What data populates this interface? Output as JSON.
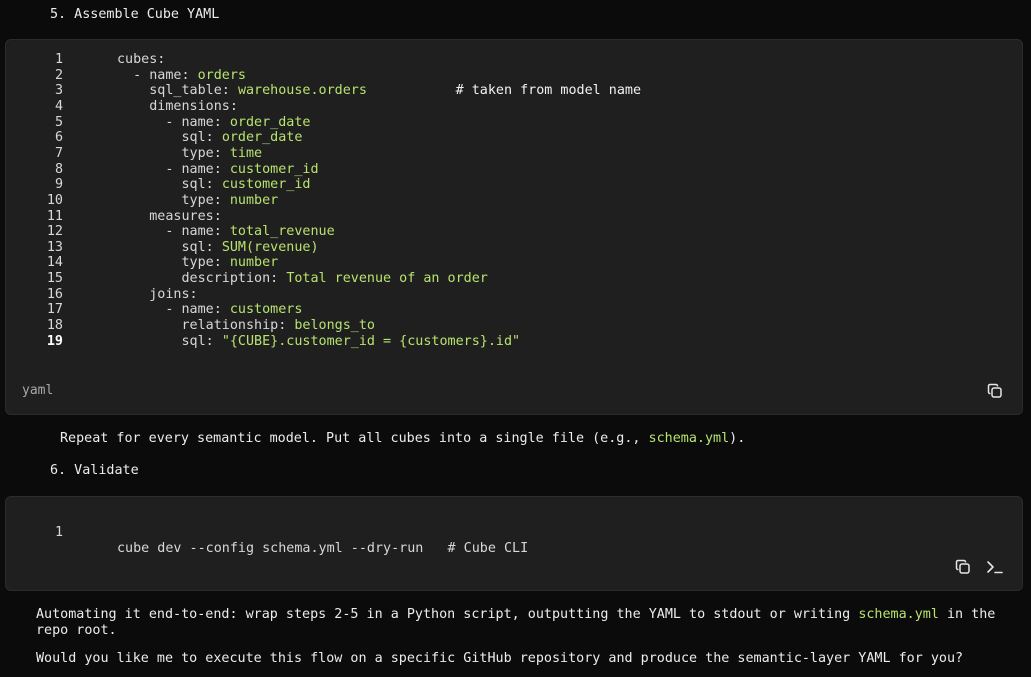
{
  "steps": {
    "assemble_heading": "5. Assemble Cube YAML",
    "validate_heading": "6. Validate"
  },
  "yaml_block": {
    "language": "yaml",
    "copy_icon": "copy-icon",
    "lines": [
      {
        "num": "1",
        "key": "cubes:",
        "value": "",
        "comment": ""
      },
      {
        "num": "2",
        "key": "  - name: ",
        "value": "orders",
        "comment": ""
      },
      {
        "num": "3",
        "key": "    sql_table: ",
        "value": "warehouse.orders",
        "comment": "           # taken from model name"
      },
      {
        "num": "4",
        "key": "    dimensions:",
        "value": "",
        "comment": ""
      },
      {
        "num": "5",
        "key": "      - name: ",
        "value": "order_date",
        "comment": ""
      },
      {
        "num": "6",
        "key": "        sql: ",
        "value": "order_date",
        "comment": ""
      },
      {
        "num": "7",
        "key": "        type: ",
        "value": "time",
        "comment": ""
      },
      {
        "num": "8",
        "key": "      - name: ",
        "value": "customer_id",
        "comment": ""
      },
      {
        "num": "9",
        "key": "        sql: ",
        "value": "customer_id",
        "comment": ""
      },
      {
        "num": "10",
        "key": "        type: ",
        "value": "number",
        "comment": ""
      },
      {
        "num": "11",
        "key": "    measures:",
        "value": "",
        "comment": ""
      },
      {
        "num": "12",
        "key": "      - name: ",
        "value": "total_revenue",
        "comment": ""
      },
      {
        "num": "13",
        "key": "        sql: ",
        "value": "SUM(revenue)",
        "comment": ""
      },
      {
        "num": "14",
        "key": "        type: ",
        "value": "number",
        "comment": ""
      },
      {
        "num": "15",
        "key": "        description: ",
        "value": "Total revenue of an order",
        "comment": ""
      },
      {
        "num": "16",
        "key": "    joins:",
        "value": "",
        "comment": ""
      },
      {
        "num": "17",
        "key": "      - name: ",
        "value": "customers",
        "comment": ""
      },
      {
        "num": "18",
        "key": "        relationship: ",
        "value": "belongs_to",
        "comment": ""
      },
      {
        "num": "19",
        "key": "        sql: ",
        "value": "\"{CUBE}.customer_id = {customers}.id\"",
        "comment": ""
      }
    ]
  },
  "repeat_text": {
    "before": "Repeat for every semantic model. Put all cubes into a single file (e.g., ",
    "code": "schema.yml",
    "after": ")."
  },
  "cli_block": {
    "line_num": "1",
    "code": "cube dev --config schema.yml --dry-run   # Cube CLI",
    "copy_icon": "copy-icon",
    "terminal_icon": "terminal-icon"
  },
  "automating_text": {
    "before": "Automating it end-to-end: wrap steps 2-5 in a Python script, outputting the YAML to stdout or writing ",
    "code": "schema.yml",
    "after": " in the repo root."
  },
  "question_text": "Would you like me to execute this flow on a specific GitHub repository and produce the semantic-layer YAML for you?"
}
